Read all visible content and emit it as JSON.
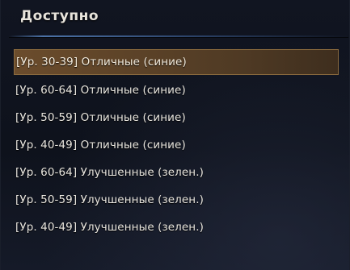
{
  "panel": {
    "title": "Доступно"
  },
  "items": [
    {
      "label": "[Ур. 30-39] Отличные (синие)",
      "selected": true
    },
    {
      "label": "[Ур. 60-64] Отличные (синие)",
      "selected": false
    },
    {
      "label": "[Ур. 50-59] Отличные (синие)",
      "selected": false
    },
    {
      "label": "[Ур. 40-49] Отличные (синие)",
      "selected": false
    },
    {
      "label": "[Ур. 60-64] Улучшенные (зелен.)",
      "selected": false
    },
    {
      "label": "[Ур. 50-59] Улучшенные (зелен.)",
      "selected": false
    },
    {
      "label": "[Ур. 40-49] Улучшенные (зелен.)",
      "selected": false
    }
  ],
  "colors": {
    "selection_fill": "#6b4c2c",
    "selection_border": "#8a6a3e",
    "divider_accent": "#5682be",
    "text": "#e9e6df"
  }
}
